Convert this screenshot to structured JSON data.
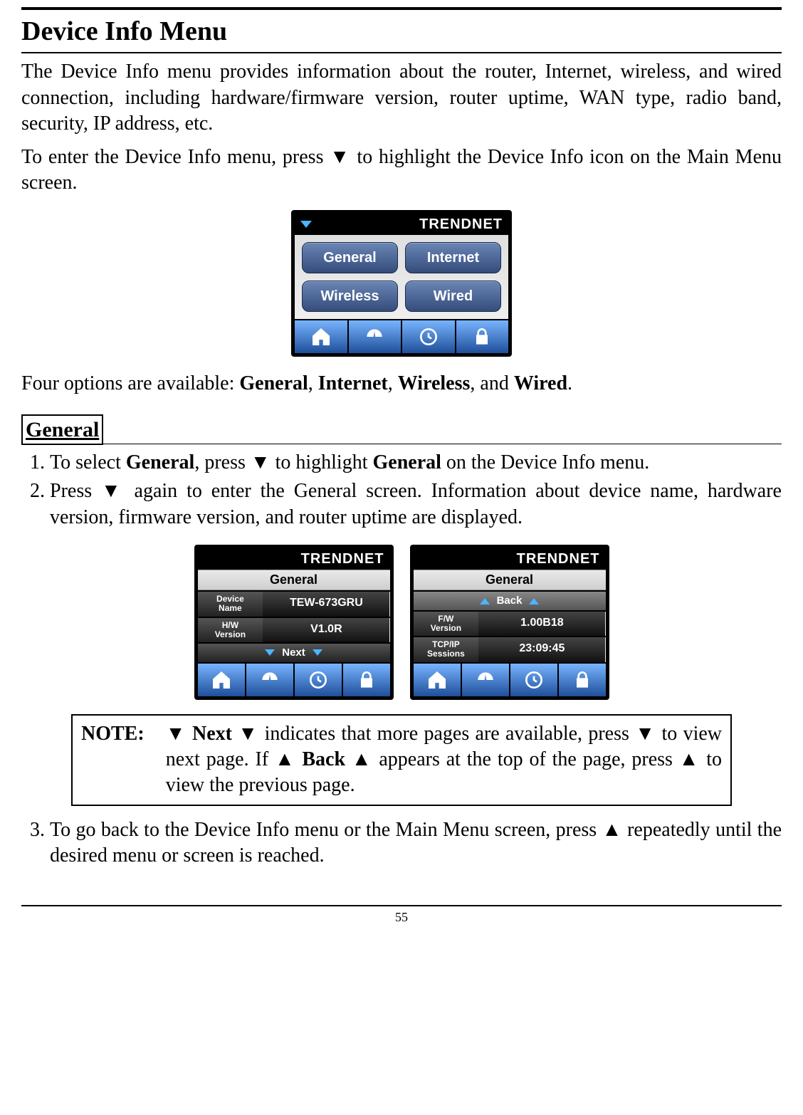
{
  "page_number": "55",
  "title": "Device Info Menu",
  "intro1": "The Device Info menu provides information about the router, Internet, wireless, and wired connection, including hardware/firmware version, router uptime, WAN type, radio band, security, IP address, etc.",
  "intro2_a": "To enter the Device Info menu, press ",
  "intro2_b": " to highlight the Device Info icon on the Main Menu screen.",
  "brand": "TRENDNET",
  "menu": {
    "items": [
      "General",
      "Internet",
      "Wireless",
      "Wired"
    ]
  },
  "options_a": "Four options are available: ",
  "options_g": "General",
  "options_i": "Internet",
  "options_w": "Wireless",
  "options_wd": "Wired",
  "sep1": ", ",
  "sep2": ", ",
  "sep3": ", and ",
  "sep4": ".",
  "section": "General",
  "step1_a": "To select ",
  "step1_b": ", press ",
  "step1_c": " to highlight ",
  "step1_d": " on the Device Info menu.",
  "step2_a": "Press ",
  "step2_b": " again to enter the General screen. Information about device name, hardware version, firmware version, and router uptime are displayed.",
  "gen1": {
    "title": "General",
    "rows": [
      {
        "k": "Device\nName",
        "v": "TEW-673GRU"
      },
      {
        "k": "H/W\nVersion",
        "v": "V1.0R"
      }
    ],
    "nav": "Next"
  },
  "gen2": {
    "title": "General",
    "back": "Back",
    "rows": [
      {
        "k": "F/W\nVersion",
        "v": "1.00B18"
      },
      {
        "k": "TCP/IP\nSessions",
        "v": "23:09:45"
      }
    ]
  },
  "note_label": "NOTE:",
  "note_a": " Next ",
  "note_b": " indicates that more pages are available, press ",
  "note_c": " to view next page. If ",
  "note_d": " Back ",
  "note_e": " appears at the top of the page, press ",
  "note_f": " to view the previous page.",
  "step3_a": "To go back to the Device Info menu or the Main Menu screen, press ",
  "step3_b": " repeatedly until the desired menu or screen is reached.",
  "arrows": {
    "down": "▼",
    "up": "▲"
  }
}
